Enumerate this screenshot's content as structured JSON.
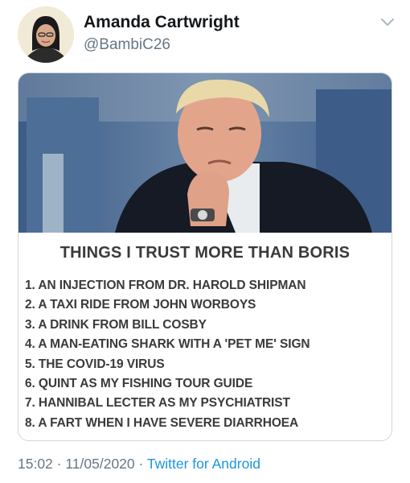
{
  "tweet": {
    "author_name": "Amanda Cartwright",
    "author_handle": "@BambiC26",
    "avatar_icon": "profile-photo",
    "menu_icon": "chevron-down-icon"
  },
  "meme": {
    "title": "THINGS I TRUST MORE THAN BORIS",
    "items": [
      "1. AN INJECTION FROM DR. HAROLD SHIPMAN",
      "2. A TAXI RIDE FROM JOHN WORBOYS",
      "3. A DRINK FROM BILL COSBY",
      "4. A MAN-EATING SHARK WITH A 'PET ME' SIGN",
      "5. THE COVID-19 VIRUS",
      "6. QUINT AS MY FISHING TOUR GUIDE",
      "7. HANNIBAL LECTER AS MY PSYCHIATRIST",
      "8. A FART WHEN I HAVE SEVERE DIARRHOEA"
    ]
  },
  "footer": {
    "time": "15:02",
    "separator": " · ",
    "date": "11/05/2020",
    "source": "Twitter for Android"
  },
  "colors": {
    "link": "#1b95e0",
    "muted": "#657786",
    "text": "#14171a",
    "meme_text": "#3a3a3a"
  }
}
